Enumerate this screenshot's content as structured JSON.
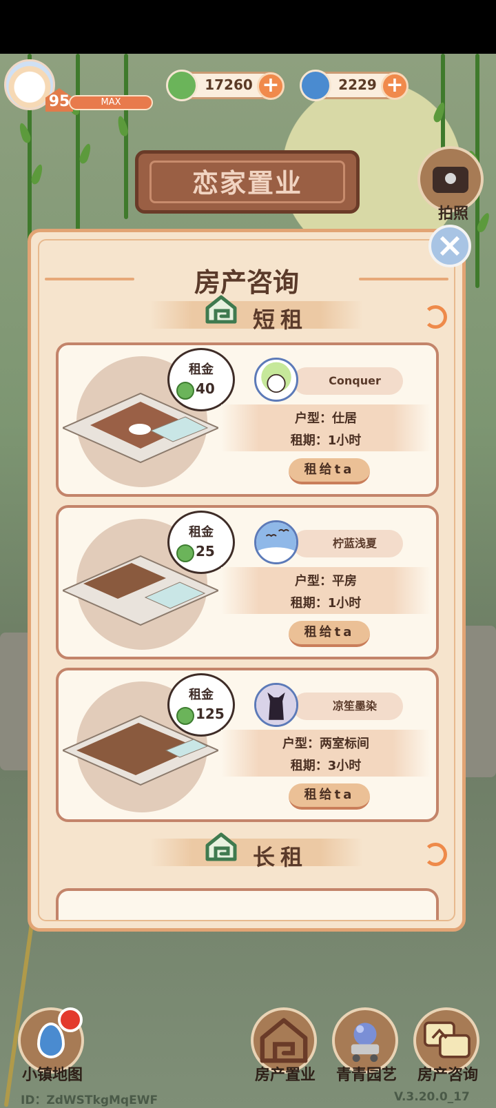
{
  "hud": {
    "level": "95",
    "xp_label": "MAX",
    "currency_leaf": "17260",
    "currency_swirl": "2229",
    "plus_symbol": "+"
  },
  "sign": {
    "title": "恋家置业"
  },
  "camera": {
    "label": "拍照"
  },
  "panel": {
    "title": "房产咨询",
    "close_symbol": "×",
    "short_rent_header": "短租",
    "long_rent_header": "长租",
    "listings": [
      {
        "rent_label": "租金",
        "price": "40",
        "tenant": "Conquer",
        "type": "户型：仕居",
        "duration": "租期：1小时",
        "action": "租给ta"
      },
      {
        "rent_label": "租金",
        "price": "25",
        "tenant": "柠蓝浅夏",
        "type": "户型：平房",
        "duration": "租期：1小时",
        "action": "租给ta"
      },
      {
        "rent_label": "租金",
        "price": "125",
        "tenant": "凉笙墨染",
        "type": "户型：两室标间",
        "duration": "租期：3小时",
        "action": "租给ta"
      }
    ]
  },
  "bottom_nav": {
    "map": "小镇地图",
    "property": "房产置业",
    "garden": "青青园艺",
    "consult": "房产咨询"
  },
  "footer": {
    "id": "ID：ZdWSTkgMqEWF",
    "version": "V.3.20.0_17"
  },
  "colors": {
    "panel_bg": "#f6e4cd",
    "panel_border": "#e2a474",
    "accent_orange": "#ee8a4a",
    "text_brown": "#5a3a2a"
  }
}
